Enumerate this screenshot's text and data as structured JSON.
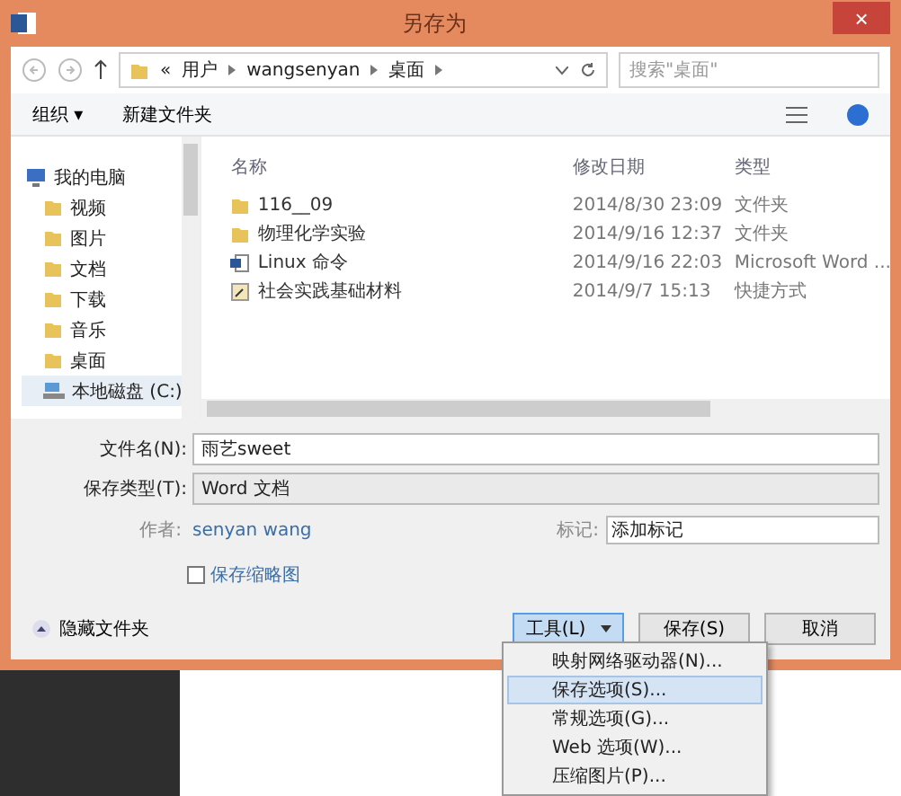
{
  "window": {
    "title": "另存为",
    "close": "×"
  },
  "nav": {
    "breadcrumb_prefix": "«",
    "path": [
      "用户",
      "wangsenyan",
      "桌面"
    ],
    "search": {
      "placeholder": "搜索\"桌面\""
    }
  },
  "toolbar": {
    "organize": "组织 ▾",
    "new_folder": "新建文件夹"
  },
  "sidebar": {
    "items": [
      {
        "label": "我的电脑",
        "kind": "computer",
        "selected": false,
        "children": [
          {
            "label": "视频",
            "kind": "folder",
            "selected": false
          },
          {
            "label": "图片",
            "kind": "folder",
            "selected": false
          },
          {
            "label": "文档",
            "kind": "folder",
            "selected": false
          },
          {
            "label": "下载",
            "kind": "folder",
            "selected": false
          },
          {
            "label": "音乐",
            "kind": "folder",
            "selected": false
          },
          {
            "label": "桌面",
            "kind": "folder",
            "selected": false
          },
          {
            "label": "本地磁盘 (C:)",
            "kind": "drive",
            "selected": true
          }
        ]
      }
    ]
  },
  "table": {
    "columns": [
      "名称",
      "修改日期",
      "类型"
    ],
    "rows": [
      {
        "kind": "folder",
        "name": "116__09",
        "date": "2014/8/30 23:09",
        "type": "文件夹"
      },
      {
        "kind": "folder",
        "name": "物理化学实验",
        "date": "2014/9/16 12:37",
        "type": "文件夹"
      },
      {
        "kind": "word",
        "name": "Linux 命令",
        "date": "2014/9/16 22:03",
        "type": "Microsoft Word ..."
      },
      {
        "kind": "shortcut",
        "name": "社会实践基础材料",
        "date": "2014/9/7 15:13",
        "type": "快捷方式"
      }
    ]
  },
  "form": {
    "filename_label": "文件名(N):",
    "filename": "雨艺sweet",
    "type_label": "保存类型(T):",
    "type": "Word 文档",
    "author_label": "作者:",
    "author": "senyan wang",
    "tags_label": "标记:",
    "tags_placeholder": "添加标记",
    "thumbnail": {
      "label": "保存缩略图",
      "checked": false
    }
  },
  "footer": {
    "hide_folders": "隐藏文件夹",
    "buttons": [
      {
        "label": "工具(L)",
        "kind": "menu",
        "selected": true
      },
      {
        "label": "保存(S)",
        "kind": "primary",
        "selected": false
      },
      {
        "label": "取消",
        "kind": "plain",
        "selected": false
      }
    ]
  },
  "menu": {
    "items": [
      {
        "label": "映射网络驱动器(N)...",
        "selected": false
      },
      {
        "label": "保存选项(S)...",
        "selected": true
      },
      {
        "label": "常规选项(G)...",
        "selected": false
      },
      {
        "label": "Web 选项(W)...",
        "selected": false
      },
      {
        "label": "压缩图片(P)...",
        "selected": false
      }
    ]
  }
}
